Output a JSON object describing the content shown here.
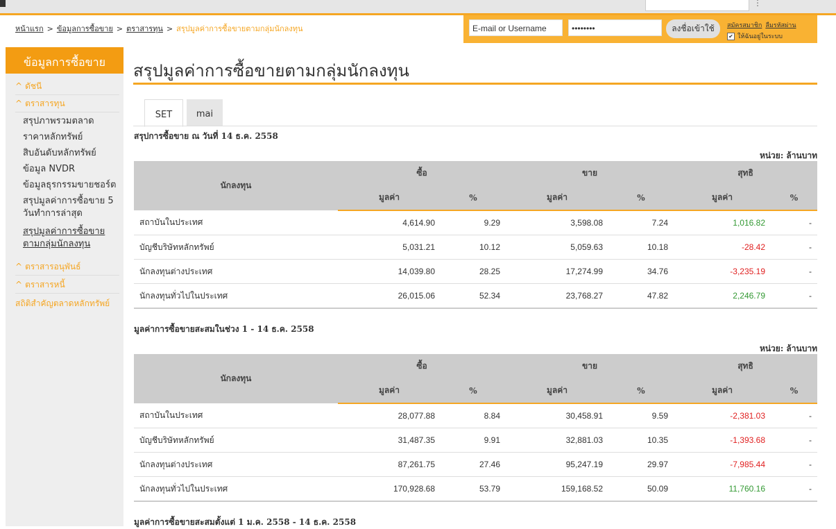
{
  "breadcrumb": {
    "home": "หน้าแรก",
    "trading": "ข้อมูลการซื้อขาย",
    "stocks": "ตราสารทุน",
    "current": "สรุปมูลค่าการซื้อขายตามกลุ่มนักลงทุน",
    "sep": ">"
  },
  "login": {
    "username_placeholder": "E-mail or Username",
    "password_value": "••••••••",
    "submit_label": "ลงชื่อเข้าใช้",
    "register_label": "สมัครสมาชิก",
    "forgot_label": "ลืมรหัสผ่าน",
    "remember_label": "ให้ฉันอยู่ในระบบ",
    "remember_checked": "✔"
  },
  "sidebar": {
    "heading": "ข้อมูลการซื้อขาย",
    "caret": "^",
    "cat_index": "ดัชนี",
    "cat_stocks": "ตราสารทุน",
    "items": [
      "สรุปภาพรวมตลาด",
      "ราคาหลักทรัพย์",
      "สิบอันดับหลักทรัพย์",
      "ข้อมูล NVDR",
      "ข้อมูลธุรกรรมขายชอร์ต",
      "สรุปมูลค่าการซื้อขาย 5 วันทำการล่าสุด",
      "สรุปมูลค่าการซื้อขายตามกลุ่มนักลงทุน"
    ],
    "cat_derivatives": "ตราสารอนุพันธ์",
    "cat_bonds": "ตราสารหนี้",
    "stats": "สถิติสำคัญตลาดหลักทรัพย์"
  },
  "page": {
    "title": "สรุปมูลค่าการซื้อขายตามกลุ่มนักลงทุน",
    "tabs": [
      "SET",
      "mai"
    ]
  },
  "headers": {
    "investor": "นักลงทุน",
    "buy": "ซื้อ",
    "sell": "ขาย",
    "net": "สุทธิ",
    "value": "มูลค่า",
    "pct": "%"
  },
  "unit": "หน่วย: ล้านบาท",
  "section1": {
    "title": "สรุปการซื้อขาย ณ วันที่ 14 ธ.ค. 2558",
    "rows": [
      {
        "name": "สถาบันในประเทศ",
        "buy": "4,614.90",
        "buy_pct": "9.29",
        "sell": "3,598.08",
        "sell_pct": "7.24",
        "net": "1,016.82",
        "net_pct": "-"
      },
      {
        "name": "บัญชีบริษัทหลักทรัพย์",
        "buy": "5,031.21",
        "buy_pct": "10.12",
        "sell": "5,059.63",
        "sell_pct": "10.18",
        "net": "-28.42",
        "net_pct": "-"
      },
      {
        "name": "นักลงทุนต่างประเทศ",
        "buy": "14,039.80",
        "buy_pct": "28.25",
        "sell": "17,274.99",
        "sell_pct": "34.76",
        "net": "-3,235.19",
        "net_pct": "-"
      },
      {
        "name": "นักลงทุนทั่วไปในประเทศ",
        "buy": "26,015.06",
        "buy_pct": "52.34",
        "sell": "23,768.27",
        "sell_pct": "47.82",
        "net": "2,246.79",
        "net_pct": "-"
      }
    ]
  },
  "section2": {
    "title": "มูลค่าการซื้อขายสะสมในช่วง 1 - 14 ธ.ค. 2558",
    "rows": [
      {
        "name": "สถาบันในประเทศ",
        "buy": "28,077.88",
        "buy_pct": "8.84",
        "sell": "30,458.91",
        "sell_pct": "9.59",
        "net": "-2,381.03",
        "net_pct": "-"
      },
      {
        "name": "บัญชีบริษัทหลักทรัพย์",
        "buy": "31,487.35",
        "buy_pct": "9.91",
        "sell": "32,881.03",
        "sell_pct": "10.35",
        "net": "-1,393.68",
        "net_pct": "-"
      },
      {
        "name": "นักลงทุนต่างประเทศ",
        "buy": "87,261.75",
        "buy_pct": "27.46",
        "sell": "95,247.19",
        "sell_pct": "29.97",
        "net": "-7,985.44",
        "net_pct": "-"
      },
      {
        "name": "นักลงทุนทั่วไปในประเทศ",
        "buy": "170,928.68",
        "buy_pct": "53.79",
        "sell": "159,168.52",
        "sell_pct": "50.09",
        "net": "11,760.16",
        "net_pct": "-"
      }
    ]
  },
  "section3": {
    "title": "มูลค่าการซื้อขายสะสมตั้งแต่ 1 ม.ค. 2558 - 14 ธ.ค. 2558"
  },
  "colors": {
    "accent": "#f5a623",
    "positive": "#339933",
    "negative": "#e02020",
    "header_bg": "#cccccc"
  }
}
